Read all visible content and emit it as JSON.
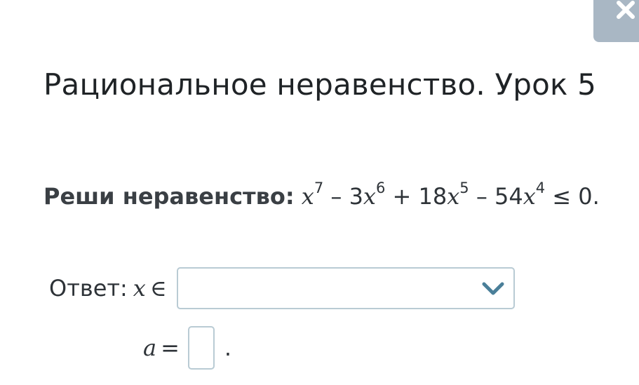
{
  "page": {
    "title": "Рациональное неравенство. Урок 5"
  },
  "task": {
    "lead": "Реши неравенство:",
    "var": "x",
    "exp1": "7",
    "op1": " – 3",
    "exp2": "6",
    "op2": " + 18",
    "exp3": "5",
    "op3": " – 54",
    "exp4": "4",
    "tail": " ≤ 0."
  },
  "answer": {
    "label": "Ответ:",
    "var": "x",
    "symbol": "∈",
    "dropdown_value": ""
  },
  "a_field": {
    "var": "a",
    "eq": "=",
    "value": "",
    "end": "."
  },
  "icons": {
    "close": "close-icon",
    "dropdown": "chevron-down-icon"
  },
  "colors": {
    "close_tab_bg": "#a9b7c4",
    "input_border": "#b9cbd4",
    "chevron": "#4a7f99"
  }
}
